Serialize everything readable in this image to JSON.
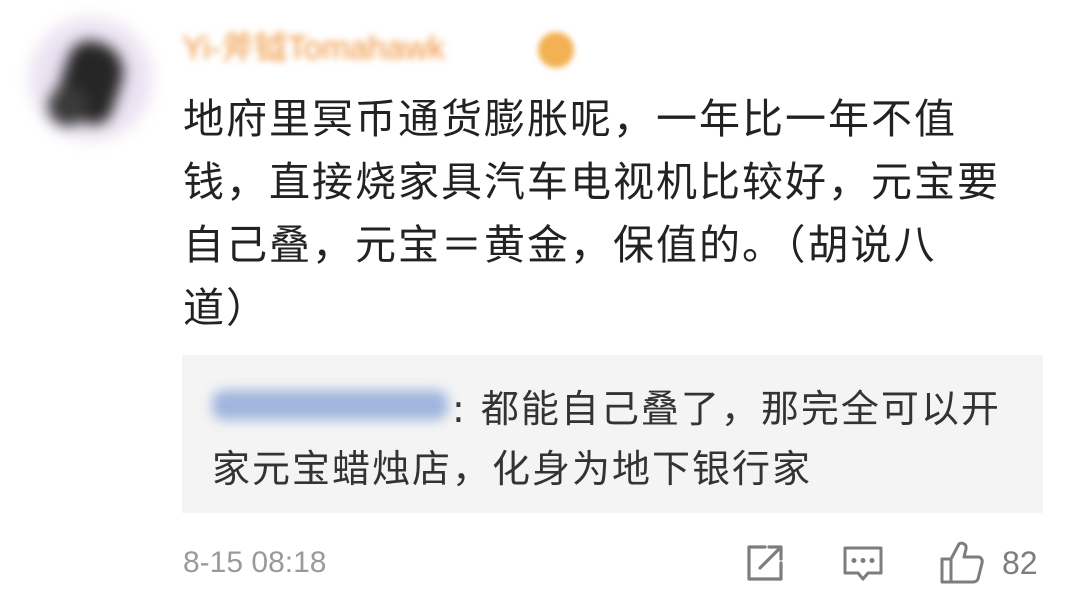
{
  "colors": {
    "username": "#f0923a",
    "text": "#222222",
    "reply_text": "#333333",
    "meta": "#9a9a9a",
    "reply_bg": "#f4f4f4",
    "reply_name": "#8aa6d8",
    "icon": "#7d7d7d"
  },
  "comment": {
    "username": "Yi-斧钺Tomahawk",
    "text_lines": [
      "地府里冥币通货膨胀呢，一年比一年不值",
      "钱，直接烧家具汽车电视机比较好，元宝要",
      "自己叠，元宝＝黄金，保值的。（胡说八",
      "道）"
    ],
    "timestamp": "8-15 08:18"
  },
  "reply": {
    "text_lines": [
      ": 都能自己叠了，那完全可以开",
      "家元宝蜡烛店，化身为地下银行家"
    ]
  },
  "actions": {
    "share_icon": "share-icon",
    "comment_icon": "comment-icon",
    "like_icon": "thumbs-up-icon",
    "like_count": "82"
  }
}
